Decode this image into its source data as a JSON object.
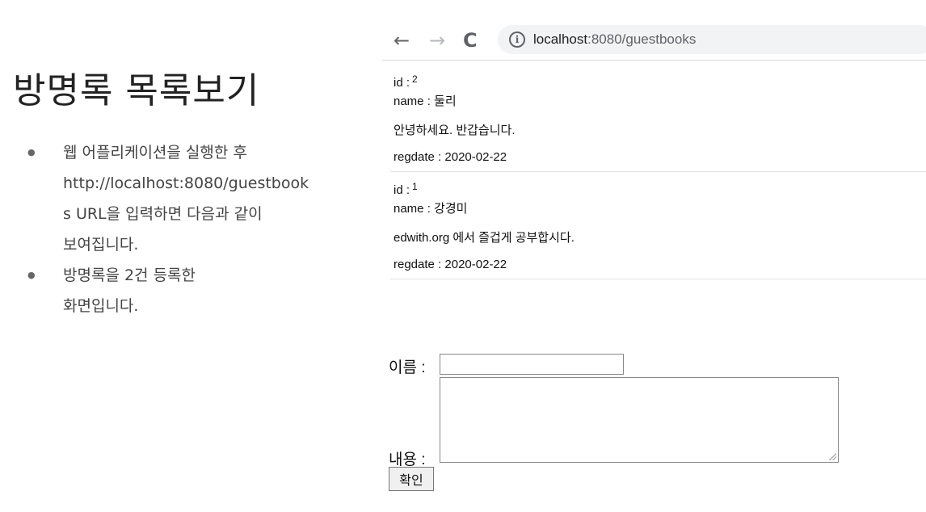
{
  "slide": {
    "title": "방명록 목록보기",
    "bullets": [
      {
        "lines": [
          "웹 어플리케이션을 실행한 후",
          "http://localhost:8080/guestbook",
          "s URL을 입력하면 다음과 같이",
          "보여집니다."
        ]
      },
      {
        "lines": [
          "방명록을 2건 등록한",
          "화면입니다."
        ]
      }
    ]
  },
  "browser": {
    "back_icon": "←",
    "forward_icon": "→",
    "reload_icon": "C",
    "info_icon": "i",
    "url_host": "localhost",
    "url_rest": ":8080/guestbooks"
  },
  "entries": [
    {
      "id_label": "id :",
      "id": "2",
      "name_label": "name :",
      "name": "둘리",
      "content": "안녕하세요. 반갑습니다.",
      "regdate_label": "regdate :",
      "regdate": "2020-02-22"
    },
    {
      "id_label": "id :",
      "id": "1",
      "name_label": "name :",
      "name": "강경미",
      "content": "edwith.org 에서 즐겁게 공부합시다.",
      "regdate_label": "regdate :",
      "regdate": "2020-02-22"
    }
  ],
  "form": {
    "name_label": "이름 :",
    "content_label": "내용 :",
    "name_value": "",
    "content_value": "",
    "submit_label": "확인"
  }
}
